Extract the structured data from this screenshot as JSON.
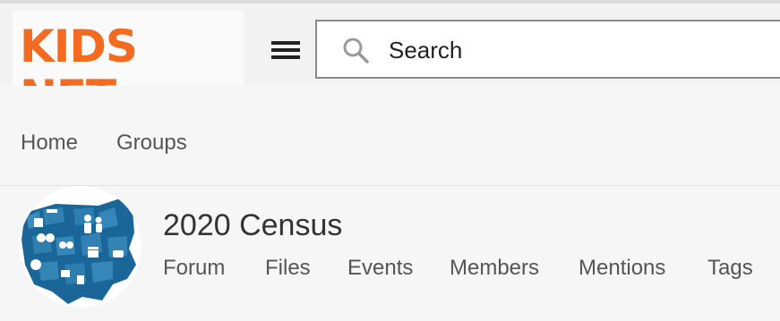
{
  "header": {
    "logo_text": "KIDS NET",
    "search": {
      "placeholder": "Search",
      "value": ""
    }
  },
  "nav": {
    "items": [
      {
        "label": "Home"
      },
      {
        "label": "Groups"
      }
    ]
  },
  "group": {
    "title": "2020 Census",
    "tabs": [
      {
        "label": "Forum"
      },
      {
        "label": "Files"
      },
      {
        "label": "Events"
      },
      {
        "label": "Members"
      },
      {
        "label": "Mentions"
      },
      {
        "label": "Tags"
      }
    ]
  },
  "colors": {
    "brand": "#f36a21",
    "avatar_bg": "#1a6698"
  },
  "icons": [
    "hamburger-menu-icon",
    "search-icon"
  ]
}
